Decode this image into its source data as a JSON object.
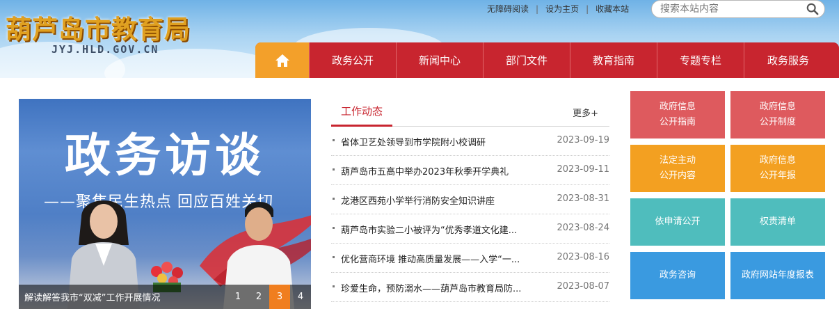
{
  "site": {
    "title": "葫芦岛市教育局",
    "domain": "JYJ.HLD.GOV.CN"
  },
  "toplinks": [
    "无障碍阅读",
    "设为主页",
    "收藏本站"
  ],
  "search": {
    "placeholder": "搜索本站内容"
  },
  "nav": {
    "home_icon": "home-icon",
    "items": [
      "政务公开",
      "新闻中心",
      "部门文件",
      "教育指南",
      "专题专栏",
      "政务服务"
    ]
  },
  "slider": {
    "banner_title": "政务访谈",
    "banner_subtitle": "——聚焦民生热点 回应百姓关切",
    "caption": "解读解答我市“双减”工作开展情况",
    "pages": [
      "1",
      "2",
      "3",
      "4"
    ],
    "active_page": "3"
  },
  "news": {
    "title": "工作动态",
    "more": "更多+",
    "items": [
      {
        "title": "省体卫艺处领导到市学院附小校调研",
        "date": "2023-09-19"
      },
      {
        "title": "葫芦岛市五高中举办2023年秋季开学典礼",
        "date": "2023-09-11"
      },
      {
        "title": "龙港区西苑小学举行消防安全知识讲座",
        "date": "2023-08-31"
      },
      {
        "title": "葫芦岛市实验二小被评为“优秀孝道文化建...",
        "date": "2023-08-24"
      },
      {
        "title": "优化营商环境 推动高质量发展——入学“一...",
        "date": "2023-08-16"
      },
      {
        "title": "珍爱生命，预防溺水——葫芦岛市教育局防...",
        "date": "2023-08-07"
      }
    ]
  },
  "tiles": [
    {
      "line1": "政府信息",
      "line2": "公开指南",
      "color": "#de5a5e"
    },
    {
      "line1": "政府信息",
      "line2": "公开制度",
      "color": "#de5a5e"
    },
    {
      "line1": "法定主动",
      "line2": "公开内容",
      "color": "#f3a021"
    },
    {
      "line1": "政府信息",
      "line2": "公开年报",
      "color": "#f3a021"
    },
    {
      "line1": "依申请公开",
      "line2": "",
      "color": "#4fbdbd"
    },
    {
      "line1": "权责清单",
      "line2": "",
      "color": "#4fbdbd"
    },
    {
      "line1": "政务咨询",
      "line2": "",
      "color": "#3a9ae0"
    },
    {
      "line1": "政府网站年度报表",
      "line2": "",
      "color": "#3a9ae0"
    }
  ],
  "colors": {
    "nav_red": "#c8252f",
    "home_orange": "#f3a02a",
    "active_page": "#f07e1f"
  }
}
